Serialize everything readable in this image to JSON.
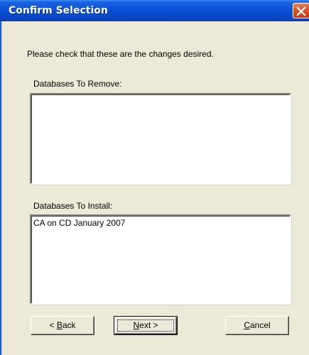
{
  "window": {
    "title": "Confirm Selection"
  },
  "instruction": "Please check that these are the changes desired.",
  "remove_group": {
    "label": "Databases To Remove:",
    "items": []
  },
  "install_group": {
    "label": "Databases To Install:",
    "items": [
      "CA on CD January 2007"
    ]
  },
  "buttons": {
    "back": {
      "prefix": "< ",
      "mnemonic": "B",
      "rest": "ack"
    },
    "next": {
      "mnemonic": "N",
      "rest": "ext >"
    },
    "cancel": {
      "mnemonic": "C",
      "rest": "ancel"
    }
  },
  "colors": {
    "title_bar": "#0A4FD6",
    "close_button": "#D3542F",
    "dialog_face": "#ECE9D8"
  },
  "icons": {
    "close": "close-icon"
  }
}
